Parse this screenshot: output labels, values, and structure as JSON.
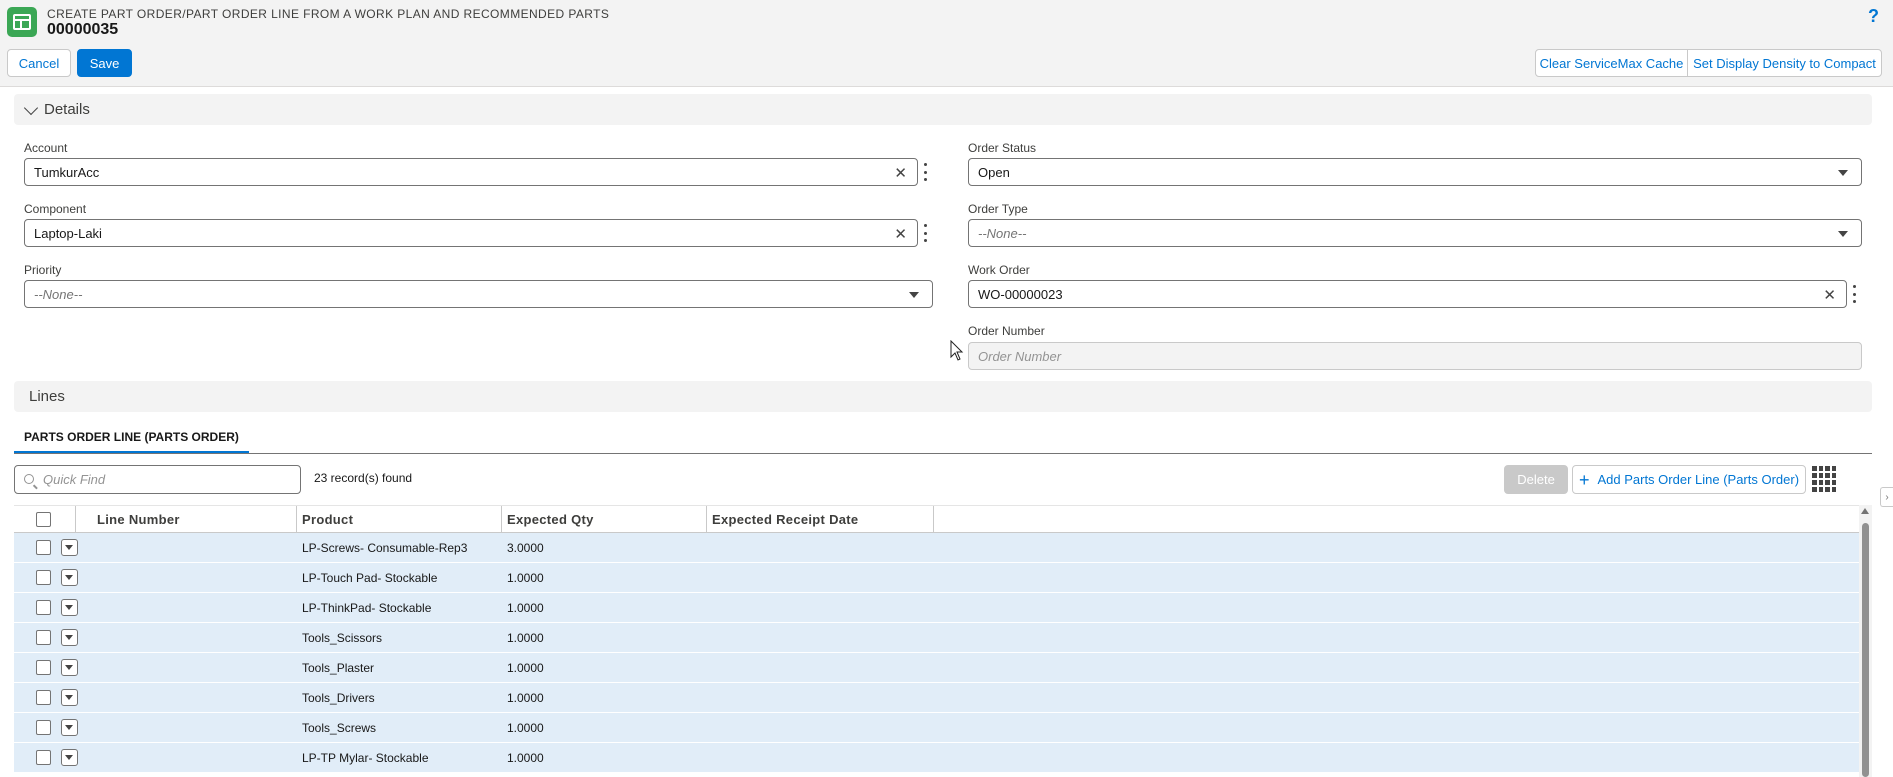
{
  "header": {
    "subtitle": "CREATE PART ORDER/PART ORDER LINE FROM A WORK PLAN AND RECOMMENDED PARTS",
    "title": "00000035",
    "help": "?",
    "cancel_label": "Cancel",
    "save_label": "Save",
    "clear_cache_label": "Clear ServiceMax Cache",
    "density_label": "Set Display Density to Compact"
  },
  "details": {
    "section_label": "Details",
    "account": {
      "label": "Account",
      "value": "TumkurAcc"
    },
    "component": {
      "label": "Component",
      "value": "Laptop-Laki"
    },
    "priority": {
      "label": "Priority",
      "value": "--None--"
    },
    "order_status": {
      "label": "Order Status",
      "value": "Open"
    },
    "order_type": {
      "label": "Order Type",
      "value": "--None--"
    },
    "work_order": {
      "label": "Work Order",
      "value": "WO-00000023"
    },
    "order_number": {
      "label": "Order Number",
      "placeholder": "Order Number"
    }
  },
  "lines": {
    "section_label": "Lines",
    "tab_label": "PARTS ORDER LINE (PARTS ORDER)",
    "quick_find_placeholder": "Quick Find",
    "records_found": "23 record(s) found",
    "delete_label": "Delete",
    "add_label": "Add Parts Order Line (Parts Order)",
    "columns": [
      "Line Number",
      "Product",
      "Expected Qty",
      "Expected Receipt Date"
    ],
    "rows": [
      {
        "line_number": "",
        "product": "LP-Screws- Consumable-Rep3",
        "qty": "3.0000",
        "receipt_date": ""
      },
      {
        "line_number": "",
        "product": "LP-Touch Pad- Stockable",
        "qty": "1.0000",
        "receipt_date": ""
      },
      {
        "line_number": "",
        "product": "LP-ThinkPad- Stockable",
        "qty": "1.0000",
        "receipt_date": ""
      },
      {
        "line_number": "",
        "product": "Tools_Scissors",
        "qty": "1.0000",
        "receipt_date": ""
      },
      {
        "line_number": "",
        "product": "Tools_Plaster",
        "qty": "1.0000",
        "receipt_date": ""
      },
      {
        "line_number": "",
        "product": "Tools_Drivers",
        "qty": "1.0000",
        "receipt_date": ""
      },
      {
        "line_number": "",
        "product": "Tools_Screws",
        "qty": "1.0000",
        "receipt_date": ""
      },
      {
        "line_number": "",
        "product": "LP-TP Mylar- Stockable",
        "qty": "1.0000",
        "receipt_date": ""
      }
    ]
  },
  "colors": {
    "brand": "#0176d3",
    "app_icon": "#3ba755",
    "row_highlight": "#e1edf8"
  }
}
